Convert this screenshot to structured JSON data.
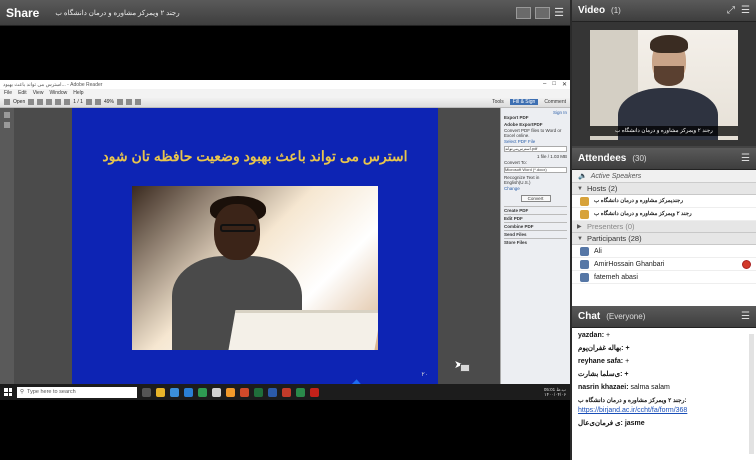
{
  "share": {
    "title": "Share",
    "presenter": "رجند ۲ ویمرکز مشاوره و درمان دانشگاه ب"
  },
  "reader": {
    "window_title": "استرس می تواند باعث بهبود... - Adobe Reader",
    "menu": [
      "File",
      "Edit",
      "View",
      "Window",
      "Help"
    ],
    "open_label": "Open",
    "page_field": "1 / 1",
    "zoom_field": "49%",
    "tabs": [
      "Tools",
      "Fill & Sign",
      "Comment"
    ],
    "active_tab": "Fill & Sign"
  },
  "slide": {
    "title": "استرس می تواند باعث بهبود وضعیت حافظه تان شود",
    "page_number": "۲۰",
    "title_color": "#e8c54c",
    "bg_color": "#0d24b4"
  },
  "tools_panel": {
    "sign_in": "Sign In",
    "export_head": "Export PDF",
    "export_product": "Adobe ExportPDF",
    "export_desc": "Convert PDF files to Word or Excel online.",
    "select_file": "Select PDF File",
    "file_name": "استرس‌می‌تواند.pdf",
    "file_count": "1 file / 1.03 MB",
    "convert_to_label": "Convert To:",
    "convert_to_value": "Microsoft Word (*.docx)",
    "recognize": "Recognize Text in English(U.S.)",
    "change": "Change",
    "convert_button": "Convert",
    "sections": [
      "Create PDF",
      "Edit PDF",
      "Combine PDF",
      "Send Files",
      "Store Files"
    ]
  },
  "taskbar": {
    "search_placeholder": "Type here to search",
    "time": "05:01 ب.ظ",
    "date": "۱۴۰۰/۰۴/۰۶"
  },
  "video": {
    "title": "Video",
    "count": "(1)",
    "caption": "رجند ۲ ویمرکز مشاوره و درمان دانشگاه ب"
  },
  "attendees": {
    "title": "Attendees",
    "count": "(30)",
    "active_speakers": "Active Speakers",
    "hosts_label": "Hosts (2)",
    "hosts": [
      "رجندیمرکز مشاوره و درمان دانشگاه ب",
      "رجند ۲ ویمرکز مشاوره و درمان دانشگاه ب"
    ],
    "presenters_label": "Presenters (0)",
    "participants_label": "Participants (28)",
    "participants": [
      "Ali",
      "AmirHossain Ghanbari",
      "fatemeh abasi"
    ]
  },
  "chat": {
    "title": "Chat",
    "scope": "(Everyone)",
    "messages": [
      {
        "who": "yazdan:",
        "text": "+"
      },
      {
        "who": "",
        "text": "+ :بهاله غفران‌پوم"
      },
      {
        "who": "reyhane safa:",
        "text": "+"
      },
      {
        "who": "",
        "text": "+ :ی‌سلما بشارت"
      },
      {
        "who": "nasrin khazaei:",
        "text": "salma salam"
      },
      {
        "who": "",
        "text": ":رجند ۲ ویمرکز مشاوره و درمان دانشگاه ب"
      },
      {
        "who": "",
        "text": "https://birjand.ac.ir/ccht/fa/form/368"
      },
      {
        "who": "",
        "text": "jasme :ی فرمان‌ی‌عال"
      }
    ]
  },
  "colors": {
    "header_dark": "#3e3e3e",
    "host_icon": "#d7a23a",
    "participant_icon": "#5677a6",
    "link": "#1a4fb8"
  }
}
